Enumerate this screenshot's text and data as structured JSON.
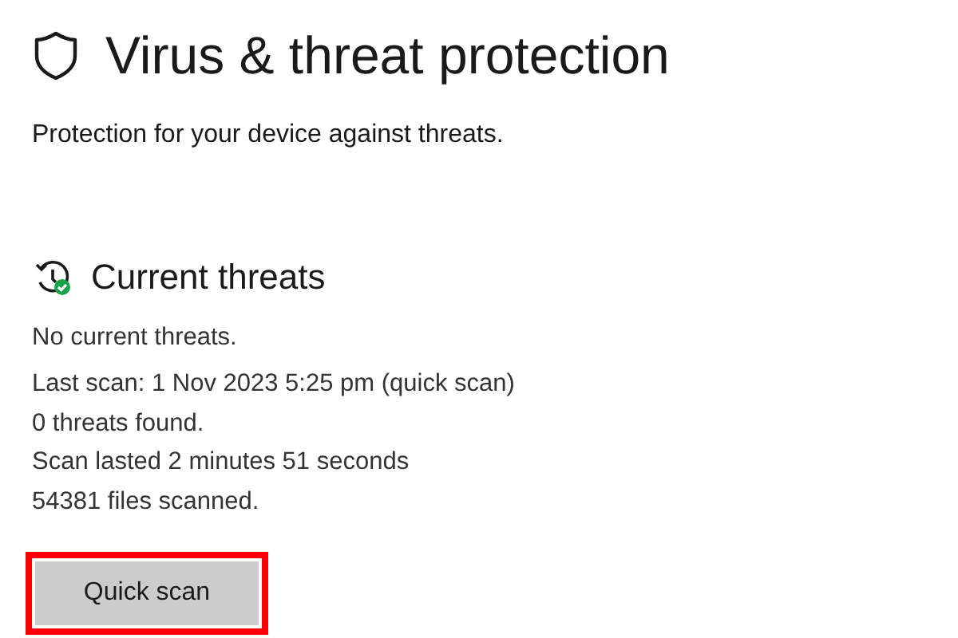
{
  "page": {
    "title": "Virus & threat protection",
    "subtitle": "Protection for your device against threats."
  },
  "section": {
    "title": "Current threats",
    "status": "No current threats.",
    "details": [
      "Last scan: 1 Nov 2023 5:25 pm (quick scan)",
      "0 threats found.",
      "Scan lasted 2 minutes 51 seconds",
      "54381 files scanned."
    ]
  },
  "button": {
    "label": "Quick scan",
    "highlighted": true
  }
}
